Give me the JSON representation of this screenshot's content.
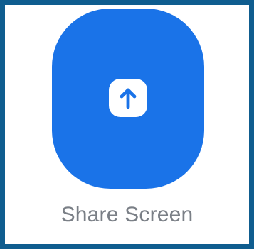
{
  "share_button": {
    "label": "Share Screen",
    "icon": "share-screen-icon",
    "colors": {
      "tile": "#1a73e8",
      "panel": "#ffffff",
      "label": "#7a7f86",
      "frame": "#0f5d8f"
    }
  }
}
